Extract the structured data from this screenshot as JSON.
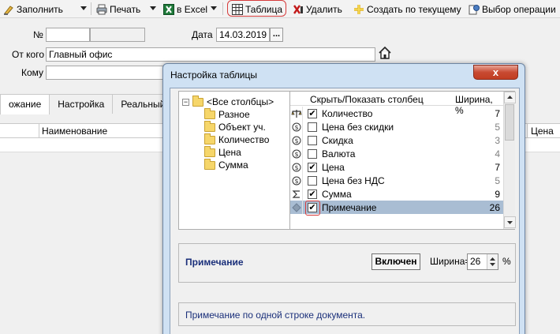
{
  "toolbar": {
    "fill_label": "Заполнить",
    "print_label": "Печать",
    "excel_label": "в Excel",
    "table_label": "Таблица",
    "delete_label": "Удалить",
    "create_label": "Создать по текущему",
    "select_op_label": "Выбор операции"
  },
  "form": {
    "number_label": "№",
    "number_value": "",
    "date_label": "Дата",
    "date_value": "14.03.2019",
    "date_button": "...",
    "from_label": "От кого",
    "from_value": "Главный офис",
    "to_label": "Кому",
    "to_value": ""
  },
  "tabs": [
    {
      "label": "ожание",
      "active": true
    },
    {
      "label": "Настройка",
      "active": false
    },
    {
      "label": "Реальный учет",
      "active": false
    }
  ],
  "grid": {
    "col_name": "Наименование",
    "col_price": "Цена"
  },
  "dialog": {
    "title": "Настройка таблицы",
    "close_glyph": "x",
    "tree": {
      "root": "<Все столбцы>",
      "items": [
        "Разное",
        "Объект уч.",
        "Количество",
        "Цена",
        "Сумма"
      ]
    },
    "columns_header": "Скрыть/Показать столбец",
    "width_header": "Ширина, %",
    "rows": [
      {
        "icon": "scales-icon",
        "checked": true,
        "name": "Количество",
        "width": "7",
        "selected": false
      },
      {
        "icon": "coin-icon",
        "checked": false,
        "name": "Цена без скидки",
        "width": "5",
        "selected": false
      },
      {
        "icon": "coin-icon",
        "checked": false,
        "name": "Скидка",
        "width": "3",
        "selected": false
      },
      {
        "icon": "coin-icon",
        "checked": false,
        "name": "Валюта",
        "width": "4",
        "selected": false
      },
      {
        "icon": "coin-icon",
        "checked": true,
        "name": "Цена",
        "width": "7",
        "selected": false
      },
      {
        "icon": "coin-icon",
        "checked": false,
        "name": "Цена без НДС",
        "width": "5",
        "selected": false
      },
      {
        "icon": "sigma-icon",
        "checked": true,
        "name": "Сумма",
        "width": "9",
        "selected": false
      },
      {
        "icon": "diamond-icon",
        "checked": true,
        "name": "Примечание",
        "width": "26",
        "selected": true
      }
    ],
    "selected_name": "Примечание",
    "enabled_button": "Включен",
    "width_label": "Ширина=",
    "width_value": "26",
    "percent": "%",
    "description": "Примечание по одной строке документа."
  }
}
